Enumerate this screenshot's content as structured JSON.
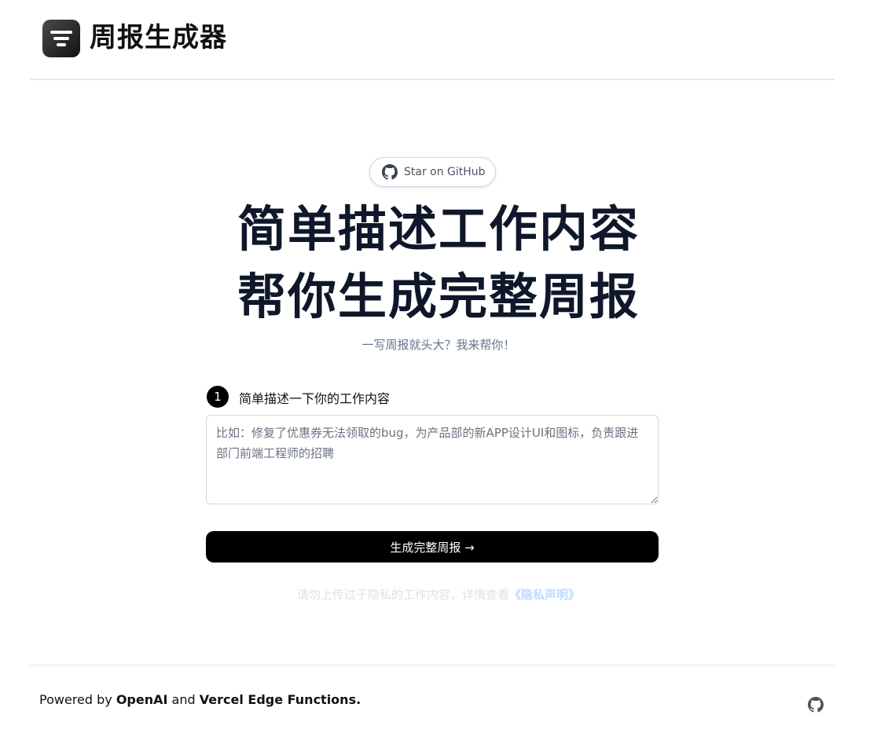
{
  "header": {
    "app_title": "周报生成器",
    "logo_icon": "filter-lines-icon"
  },
  "github_pill": {
    "label": "Star on GitHub",
    "icon": "github-icon"
  },
  "hero": {
    "line1": "简单描述工作内容",
    "line2": "帮你生成完整周报",
    "subtitle": "一写周报就头大？我来帮你！"
  },
  "step": {
    "number": "1",
    "label": "简单描述一下你的工作内容"
  },
  "description_input": {
    "value": "",
    "placeholder": "比如：修复了优惠券无法领取的bug，为产品部的新APP设计UI和图标，负责跟进部门前端工程师的招聘"
  },
  "generate_button": {
    "label": "生成完整周报 →"
  },
  "privacy": {
    "text": "请勿上传过于隐私的工作内容，详情查看",
    "link_label": "《隐私声明》"
  },
  "footer": {
    "powered_prefix": "Powered by ",
    "openai": "OpenAI",
    "and": " and ",
    "vercel": "Vercel Edge Functions.",
    "github_icon": "github-icon"
  },
  "colors": {
    "headline": "#0f172a",
    "subtitle": "#64748b",
    "button_bg": "#000000",
    "privacy_text": "#dbe2ea",
    "privacy_link": "#bfdbfe"
  }
}
